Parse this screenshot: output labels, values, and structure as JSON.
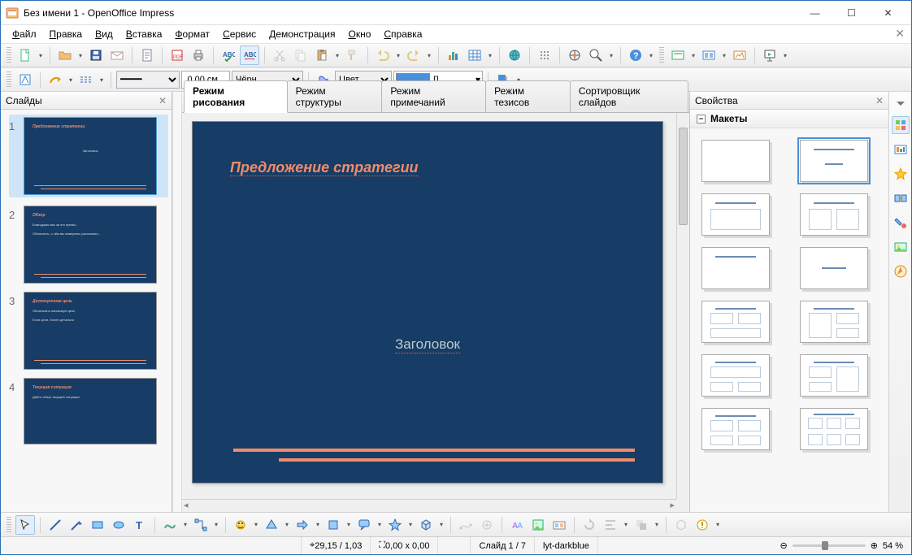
{
  "window": {
    "title": "Без имени 1 - OpenOffice Impress"
  },
  "menubar": [
    "Файл",
    "Правка",
    "Вид",
    "Вставка",
    "Формат",
    "Сервис",
    "Демонстрация",
    "Окно",
    "Справка"
  ],
  "toolbar2": {
    "linewidth": "0,00 см",
    "linecolor_label": "Чёрн",
    "fill_type": "Цвет",
    "fill_box": "[]"
  },
  "panels": {
    "slides_title": "Слайды",
    "props_title": "Свойства",
    "layouts_title": "Макеты"
  },
  "tabs": [
    "Режим рисования",
    "Режим структуры",
    "Режим примечаний",
    "Режим тезисов",
    "Сортировщик слайдов"
  ],
  "canvas": {
    "title": "Предложение стратегии",
    "subtitle": "Заголовок"
  },
  "thumbnails": [
    {
      "n": "1",
      "title": "Предложение стратегии",
      "lines": [
        "Заголовок"
      ]
    },
    {
      "n": "2",
      "title": "Обзор",
      "lines": [
        "Благодарю вас за это время...",
        "Объяснить, о чём вы намерены рассказать..."
      ]
    },
    {
      "n": "3",
      "title": "Долгосрочная цель",
      "lines": [
        "Обозначить желаемую цель",
        "Если цели, более детально"
      ]
    },
    {
      "n": "4",
      "title": "Текущая ситуация",
      "lines": [
        "Дайте обзор текущей ситуации"
      ]
    }
  ],
  "statusbar": {
    "pos": "29,15 / 1,03",
    "size": "0,00 x 0,00",
    "slide": "Слайд 1 / 7",
    "layout": "lyt-darkblue",
    "zoom": "54 %"
  },
  "icons": {
    "minimize": "—",
    "maximize": "☐",
    "close": "✕"
  }
}
